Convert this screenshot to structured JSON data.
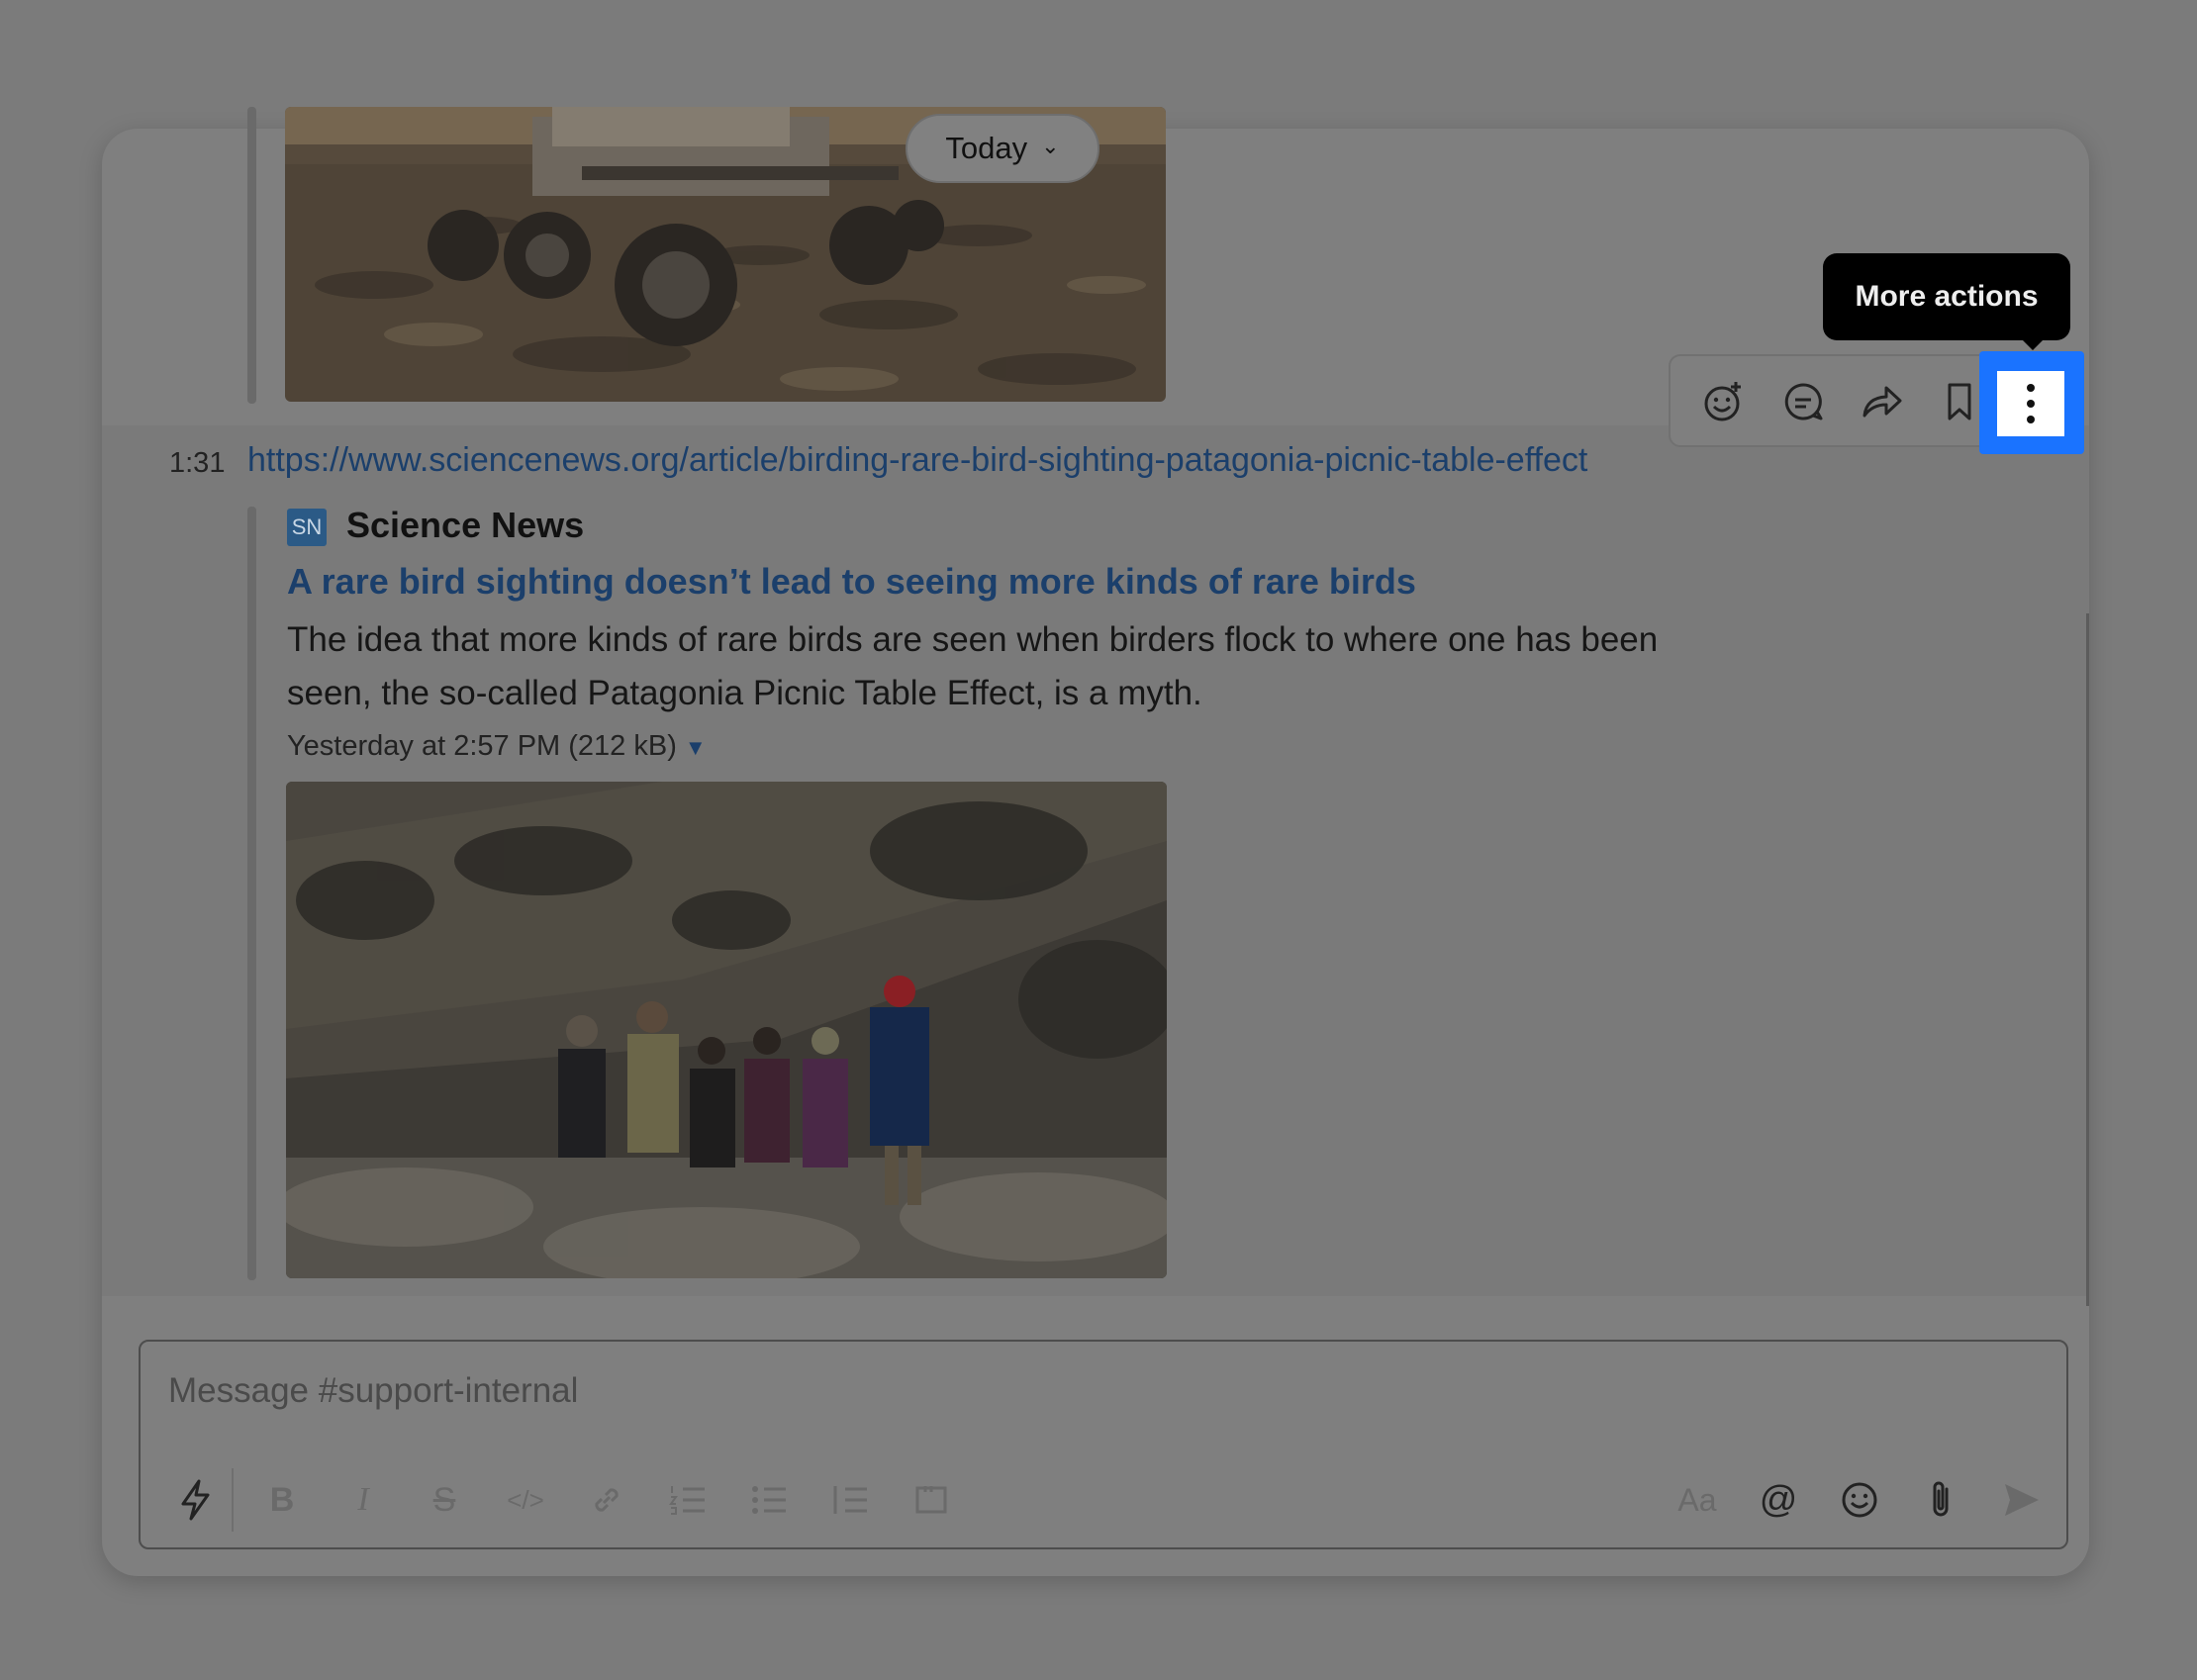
{
  "date_divider": {
    "label": "Today"
  },
  "message": {
    "time": "1:31",
    "link": "https://www.sciencenews.org/article/birding-rare-bird-sighting-patagonia-picnic-table-effect",
    "attachment": {
      "logo_text": "SN",
      "site": "Science News",
      "title": "A rare bird sighting doesn’t lead to seeing more kinds of rare birds",
      "description": "The idea that more kinds of rare birds are seen when birders flock to where one has been seen, the so-called Patagonia Picnic Table Effect, is a myth.",
      "meta": "Yesterday at 2:57 PM (212 kB)"
    }
  },
  "toolbar": {
    "tooltip": "More actions",
    "icons": [
      "add-reaction-icon",
      "reply-thread-icon",
      "share-icon",
      "bookmark-icon",
      "more-actions-icon"
    ]
  },
  "composer": {
    "placeholder": "Message #support-internal",
    "format_label": "Aa",
    "mention_symbol": "@"
  },
  "colors": {
    "highlight": "#1a73ff",
    "link": "#1b3f6b",
    "overlay": "#7b7b7b"
  }
}
